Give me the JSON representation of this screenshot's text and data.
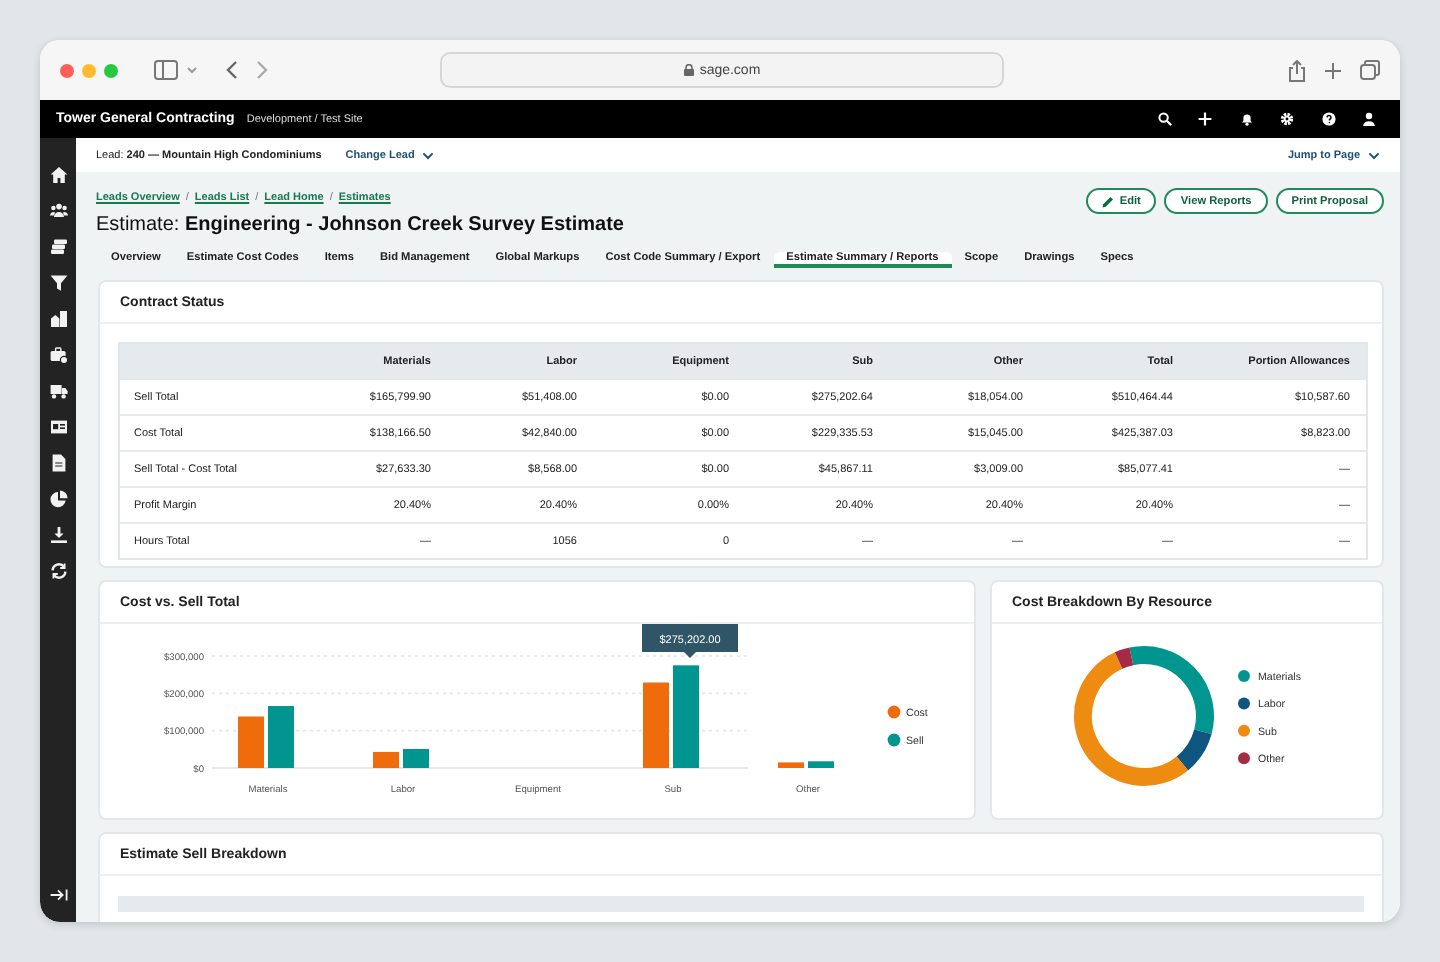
{
  "browser": {
    "url": "sage.com"
  },
  "app_bar": {
    "company": "Tower General Contracting",
    "site": "Development / Test Site"
  },
  "lead_bar": {
    "lead": "Lead: **240 — Mountain High Condominiums**",
    "change_lead": "Change Lead",
    "jump_to_page": "Jump to Page"
  },
  "breadcrumbs": {
    "separator": "/",
    "items": [
      "Leads Overview",
      "Leads List",
      "Lead Home",
      "Estimates"
    ]
  },
  "title": {
    "prefix": "Estimate:",
    "name": "Engineering - Johnson Creek Survey Estimate"
  },
  "actions": [
    {
      "label": "Edit",
      "kind": "edit"
    },
    {
      "label": "View Reports",
      "kind": "plain"
    },
    {
      "label": "Print Proposal",
      "kind": "plain"
    }
  ],
  "tabs": [
    {
      "label": "Overview",
      "selected": false
    },
    {
      "label": "Estimate Cost Codes",
      "selected": false
    },
    {
      "label": "Items",
      "selected": false
    },
    {
      "label": "Bid Management",
      "selected": false
    },
    {
      "label": "Global Markups",
      "selected": false
    },
    {
      "label": "Cost Code Summary / Export",
      "selected": false
    },
    {
      "label": "Estimate Summary / Reports",
      "selected": true
    },
    {
      "label": "Scope",
      "selected": false
    },
    {
      "label": "Drawings",
      "selected": false
    },
    {
      "label": "Specs",
      "selected": false
    }
  ],
  "contract_status": {
    "title": "Contract Status",
    "table": {
      "columns": [
        "Materials",
        "Labor",
        "Equipment",
        "Sub",
        "Other",
        "Total",
        "Portion Allowances"
      ],
      "rows": [
        {
          "label": "Sell Total",
          "cells": [
            "$165,799.90",
            "$51,408.00",
            "$0.00",
            "$275,202.64",
            "$18,054.00",
            "$510,464.44",
            "$10,587.60"
          ]
        },
        {
          "label": "Cost Total",
          "cells": [
            "$138,166.50",
            "$42,840.00",
            "$0.00",
            "$229,335.53",
            "$15,045.00",
            "$425,387.03",
            "$8,823.00"
          ]
        },
        {
          "label": "Sell Total - Cost Total",
          "cells": [
            "$27,633.30",
            "$8,568.00",
            "$0.00",
            "$45,867.11",
            "$3,009.00",
            "$85,077.41",
            "—"
          ]
        },
        {
          "label": "Profit Margin",
          "cells": [
            "20.40%",
            "20.40%",
            "0.00%",
            "20.40%",
            "20.40%",
            "20.40%",
            "—"
          ]
        },
        {
          "label": "Hours Total",
          "cells": [
            "—",
            "1056",
            "0",
            "—",
            "—",
            "—",
            "—"
          ]
        }
      ]
    }
  },
  "cost_vs_sell": {
    "title": "Cost vs. Sell Total",
    "tooltip": "$275,202.00",
    "chart_data": {
      "type": "bar",
      "categories": [
        "Materials",
        "Labor",
        "Equipment",
        "Sub",
        "Other"
      ],
      "series": [
        {
          "name": "Cost",
          "color": "#ee6c0c",
          "values": [
            138000,
            43000,
            0,
            229000,
            15000
          ]
        },
        {
          "name": "Sell",
          "color": "#00968f",
          "values": [
            166000,
            51000,
            0,
            275000,
            18000
          ]
        }
      ],
      "legend": "right",
      "ylim": [
        0,
        300000
      ],
      "yticks": [
        {
          "value": 0,
          "label": "$0"
        },
        {
          "value": 100000,
          "label": "$100,000"
        },
        {
          "value": 200000,
          "label": "$200,000"
        },
        {
          "value": 300000,
          "label": "$300,000"
        }
      ]
    }
  },
  "cost_breakdown": {
    "title": "Cost Breakdown By Resource",
    "legend": [
      {
        "label": "Materials",
        "color": "#00968f"
      },
      {
        "label": "Labor",
        "color": "#0e5580"
      },
      {
        "label": "Sub",
        "color": "#ee8c12"
      },
      {
        "label": "Other",
        "color": "#a52a44"
      }
    ]
  },
  "sell_breakdown": {
    "title": "Estimate Sell Breakdown"
  }
}
